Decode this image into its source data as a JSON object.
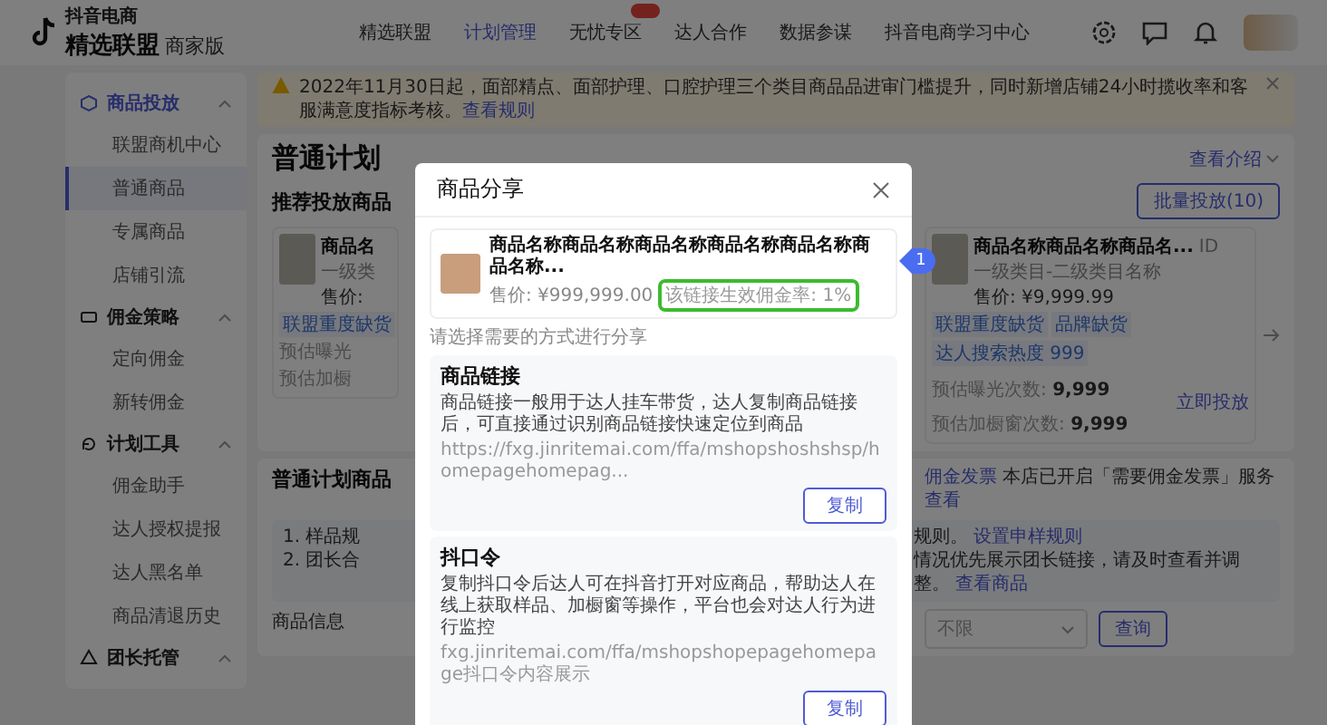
{
  "nav": {
    "logo_small": "抖音电商",
    "logo_main": "精选联盟",
    "logo_sub": "商家版",
    "tabs": [
      {
        "label": "精选联盟",
        "selected": false,
        "badge": false
      },
      {
        "label": "计划管理",
        "selected": true,
        "badge": false
      },
      {
        "label": "无忧专区",
        "selected": false,
        "badge": true
      },
      {
        "label": "达人合作",
        "selected": false,
        "badge": false
      },
      {
        "label": "数据参谋",
        "selected": false,
        "badge": false
      },
      {
        "label": "抖音电商学习中心",
        "selected": false,
        "badge": false
      }
    ]
  },
  "sidebar": {
    "groups": [
      {
        "title": "商品投放",
        "selected": true,
        "expanded": true,
        "items": [
          {
            "label": "联盟商机中心",
            "selected": false
          },
          {
            "label": "普通商品",
            "selected": true
          },
          {
            "label": "专属商品",
            "selected": false
          },
          {
            "label": "店铺引流",
            "selected": false
          }
        ]
      },
      {
        "title": "佣金策略",
        "selected": false,
        "expanded": true,
        "items": [
          {
            "label": "定向佣金",
            "selected": false
          },
          {
            "label": "新转佣金",
            "selected": false
          }
        ]
      },
      {
        "title": "计划工具",
        "selected": false,
        "expanded": true,
        "items": [
          {
            "label": "佣金助手",
            "selected": false
          },
          {
            "label": "达人授权提报",
            "selected": false
          },
          {
            "label": "达人黑名单",
            "selected": false
          },
          {
            "label": "商品清退历史",
            "selected": false
          }
        ]
      },
      {
        "title": "团长托管",
        "selected": false,
        "expanded": true
      }
    ]
  },
  "notice": {
    "text": "2022年11月30日起，面部精点、面部护理、口腔护理三个类目商品品进审门槛提升，同时新增店铺24小时揽收率和客服满意度指标考核。",
    "link": "查看规则"
  },
  "plan": {
    "title": "普通计划",
    "intro": "查看介绍"
  },
  "recommend": {
    "title": "推荐投放商品",
    "batch_button": "批量投放(10)",
    "cards": [
      {
        "name": "商品名",
        "category": "一级类",
        "price": "售价:",
        "tags": [
          "联盟重度缺货"
        ],
        "stats": [
          {
            "label": "预估曝光"
          },
          {
            "label": "预估加橱"
          }
        ]
      },
      {
        "name": "商品名称商品名称商品名...",
        "id": "ID",
        "category": "一级类目-二级类目名称",
        "price": "售价: ¥9,999.99",
        "tags": [
          "联盟重度缺货",
          "品牌缺货",
          "达人搜索热度 999"
        ],
        "stats": [
          {
            "label": "预估曝光次数:",
            "value": "9,999"
          },
          {
            "label": "预估加橱窗次数:",
            "value": "9,999"
          }
        ],
        "action": "立即投放"
      }
    ]
  },
  "general": {
    "title": "普通计划商品",
    "invoice_link": "佣金发票",
    "invoice_text": "本店已开启「需要佣金发票」服务",
    "invoice_more": "查看",
    "info_left": [
      "1. 样品规",
      "2. 团长合"
    ],
    "info_right": [
      {
        "text": "规则。",
        "link": "设置申样规则"
      },
      {
        "text": "情况优先展示团长链接，请及时查看并调整。",
        "link": "查看商品"
      }
    ],
    "filter": {
      "label": "商品信息",
      "select": "不限",
      "query": "查询"
    }
  },
  "modal": {
    "title": "商品分享",
    "product": {
      "name": "商品名称商品名称商品名称商品名称商品名称商品名称...",
      "price": "售价: ¥999,999.00",
      "rate": "该链接生效佣金率: 1%",
      "highlighted": true
    },
    "hint": "请选择需要的方式进行分享",
    "annotation": "1",
    "methods": [
      {
        "title": "商品链接",
        "desc": "商品链接一般用于达人挂车带货，达人复制商品链接后，可直接通过识别商品链接快速定位到商品",
        "url": "https://fxg.jinritemai.com/ffa/mshopshoshshsp/homepagehomepag...",
        "button": "复制"
      },
      {
        "title": "抖口令",
        "desc": "复制抖口令后达人可在抖音打开对应商品，帮助达人在线上获取样品、加橱窗等操作，平台也会对达人行为进行监控",
        "url": "fxg.jinritemai.com/ffa/mshopshopepagehomepage抖口令内容展示",
        "button": "复制"
      }
    ]
  }
}
